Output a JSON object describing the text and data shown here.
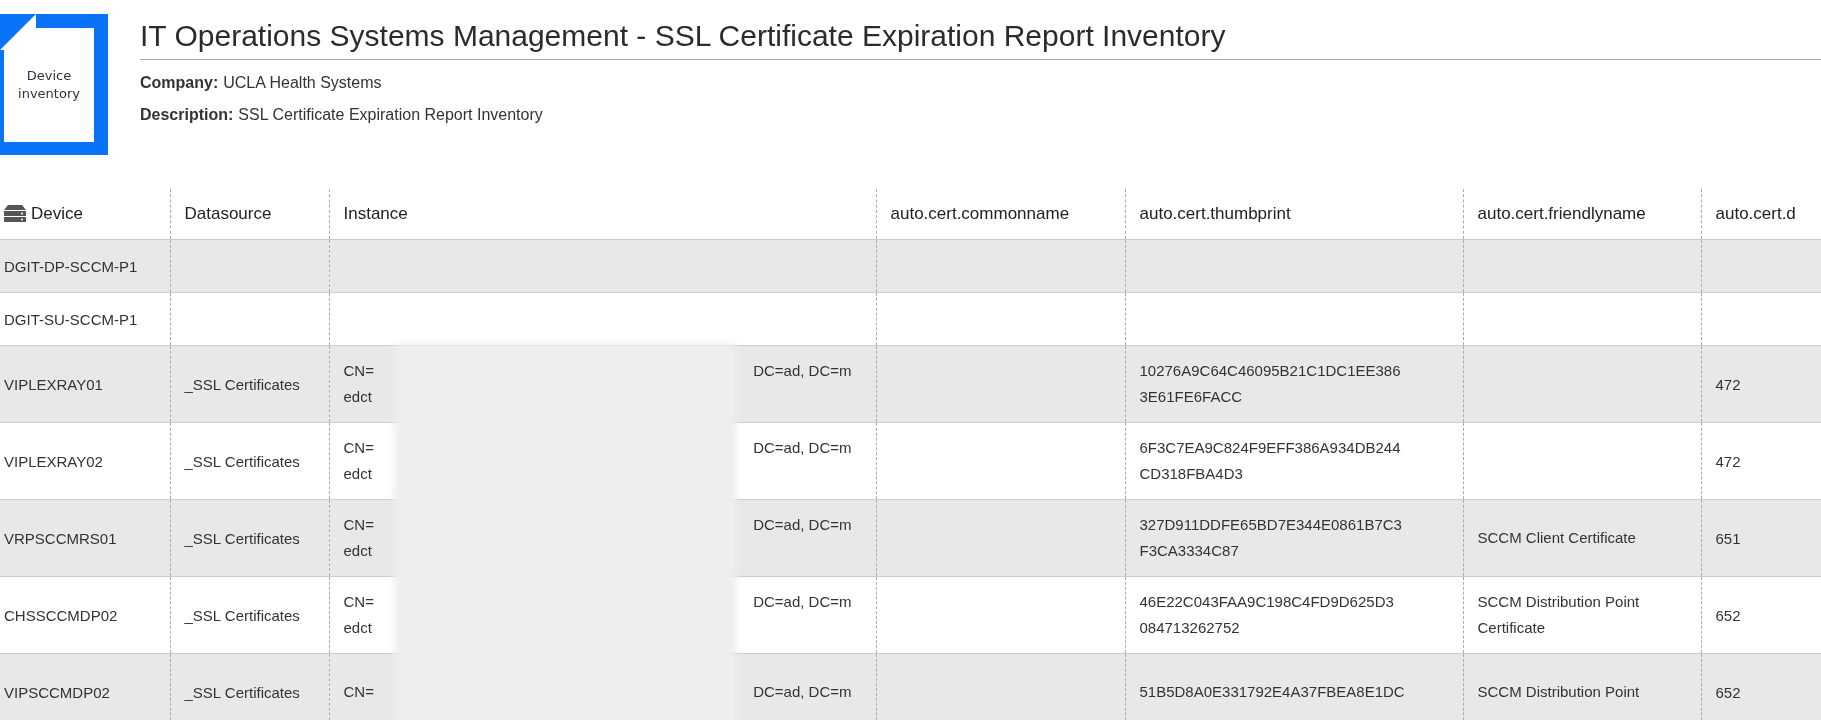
{
  "logo": {
    "label": "Device inventory"
  },
  "title": "IT Operations Systems Management - SSL Certificate Expiration Report Inventory",
  "meta": [
    {
      "label": "Company:",
      "value": "UCLA Health Systems"
    },
    {
      "label": "Description:",
      "value": "SSL Certificate Expiration Report Inventory"
    }
  ],
  "table": {
    "columns": [
      "Device",
      "Datasource",
      "Instance",
      "auto.cert.commonname",
      "auto.cert.thumbprint",
      "auto.cert.friendlyname",
      "auto.cert.d"
    ],
    "rows": [
      {
        "device": "DGIT-DP-SCCM-P1"
      },
      {
        "device": "DGIT-SU-SCCM-P1"
      },
      {
        "device": "VIPLEXRAY01",
        "datasource": "_SSL Certificates",
        "instance": {
          "start": "CN=",
          "end": "DC=ad, DC=m",
          "next": "edct",
          "redacted": true
        },
        "thumbprint": [
          "10276A9C64C46095B21C1DC1EE386",
          "3E61FE6FACC"
        ],
        "column_7": "472"
      },
      {
        "device": "VIPLEXRAY02",
        "datasource": "_SSL Certificates",
        "instance": {
          "start": "CN=",
          "end": "DC=ad, DC=m",
          "next": "edct",
          "redacted": true
        },
        "thumbprint": [
          "6F3C7EA9C824F9EFF386A934DB244",
          "CD318FBA4D3"
        ],
        "column_7": "472"
      },
      {
        "device": "VRPSCCMRS01",
        "datasource": "_SSL Certificates",
        "instance": {
          "start": "CN=",
          "end": "DC=ad, DC=m",
          "next": "edct",
          "redacted": true
        },
        "thumbprint": [
          "327D911DDFE65BD7E344E0861B7C3",
          "F3CA3334C87"
        ],
        "friendlyname": [
          "SCCM Client Certificate"
        ],
        "column_7": "651"
      },
      {
        "device": "CHSSCCMDP02",
        "datasource": "_SSL Certificates",
        "instance": {
          "start": "CN=",
          "end": "DC=ad, DC=m",
          "next": "edct",
          "redacted": true
        },
        "thumbprint": [
          "46E22C043FAA9C198C4FD9D625D3",
          "084713262752"
        ],
        "friendlyname": [
          "SCCM Distribution Point",
          "Certificate"
        ],
        "column_7": "652"
      },
      {
        "device": "VIPSCCMDP02",
        "datasource": "_SSL Certificates",
        "instance": {
          "start": "CN=",
          "end": "DC=ad, DC=m",
          "redacted": true
        },
        "thumbprint": [
          "51B5D8A0E331792E4A37FBEA8E1DC"
        ],
        "friendlyname": [
          "SCCM Distribution Point"
        ],
        "column_7": "652"
      }
    ]
  }
}
